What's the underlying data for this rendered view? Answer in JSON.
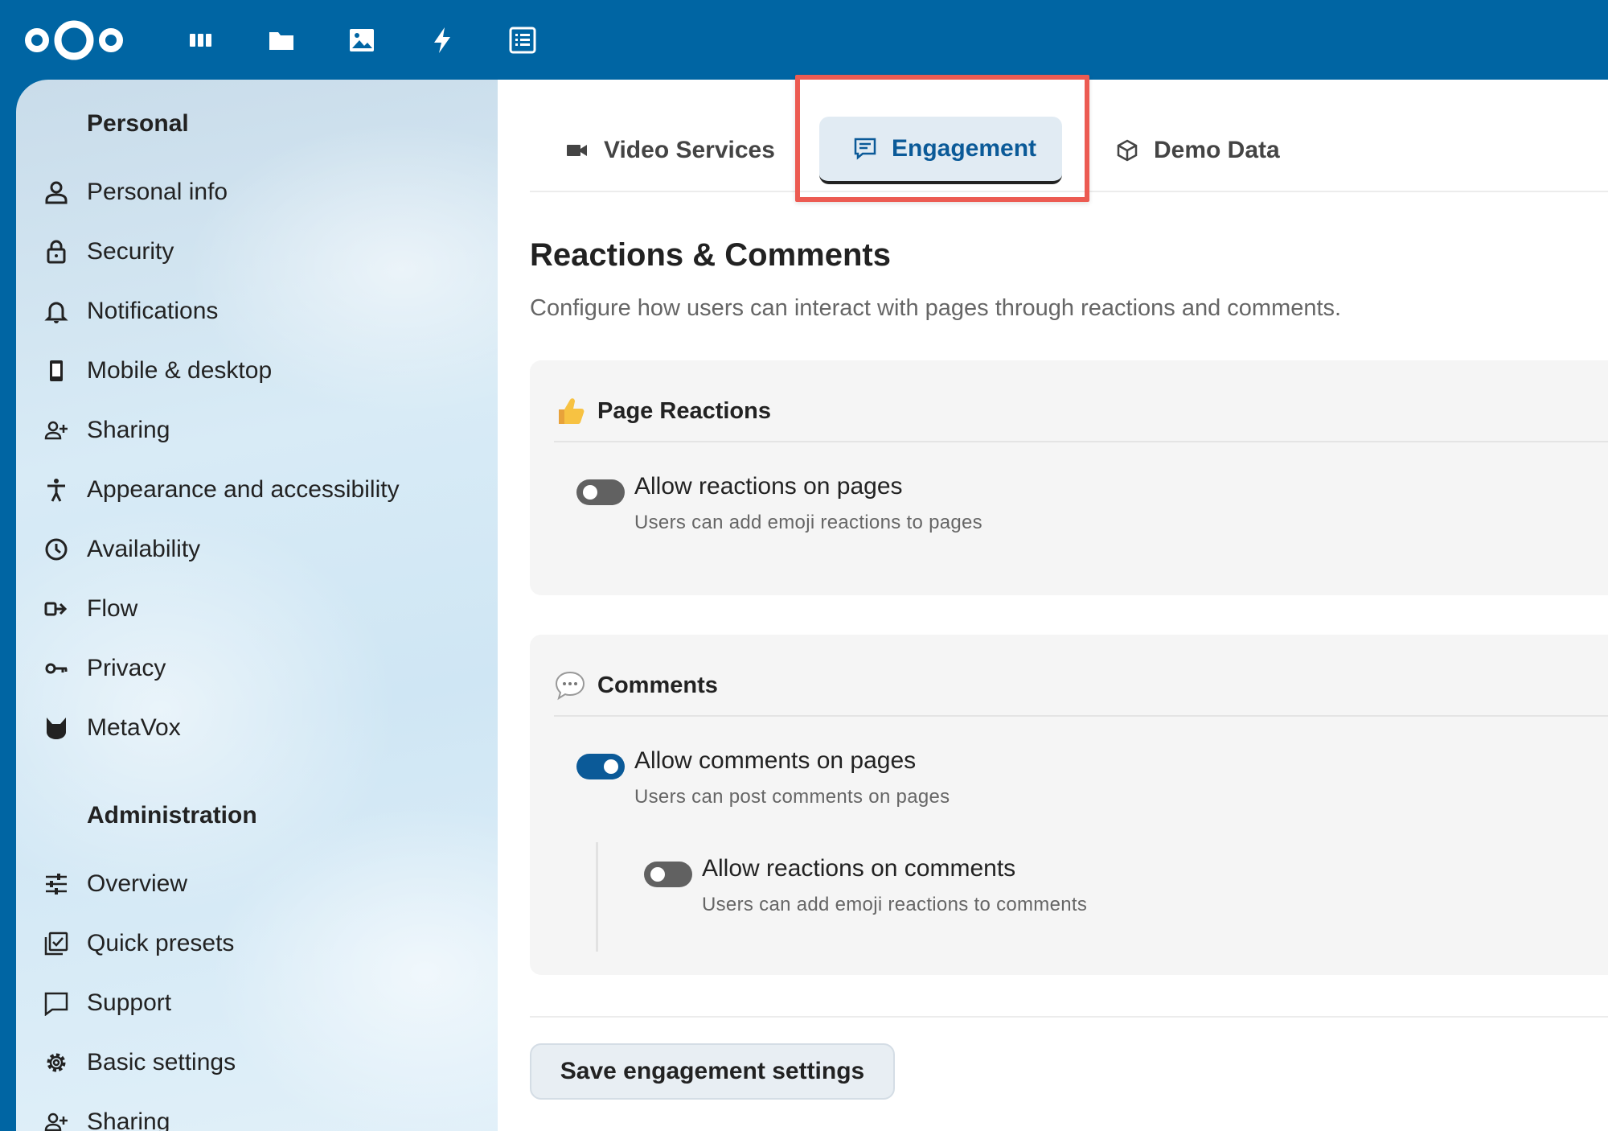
{
  "header": {
    "logo": "nextcloud-logo",
    "apps": [
      {
        "name": "dashboard",
        "icon": "dashboard-icon"
      },
      {
        "name": "files",
        "icon": "folder-icon"
      },
      {
        "name": "photos",
        "icon": "image-icon"
      },
      {
        "name": "activity",
        "icon": "lightning-icon"
      },
      {
        "name": "pages",
        "icon": "list-icon"
      }
    ]
  },
  "sidebar": {
    "personal_heading": "Personal",
    "personal_items": [
      {
        "label": "Personal info",
        "icon": "user-icon"
      },
      {
        "label": "Security",
        "icon": "lock-icon"
      },
      {
        "label": "Notifications",
        "icon": "bell-icon"
      },
      {
        "label": "Mobile & desktop",
        "icon": "phone-icon"
      },
      {
        "label": "Sharing",
        "icon": "share-user-icon"
      },
      {
        "label": "Appearance and accessibility",
        "icon": "accessibility-icon"
      },
      {
        "label": "Availability",
        "icon": "clock-icon"
      },
      {
        "label": "Flow",
        "icon": "flow-icon"
      },
      {
        "label": "Privacy",
        "icon": "key-icon"
      },
      {
        "label": "MetaVox",
        "icon": "metavox-icon"
      }
    ],
    "admin_heading": "Administration",
    "admin_items": [
      {
        "label": "Overview",
        "icon": "sliders-icon"
      },
      {
        "label": "Quick presets",
        "icon": "checklist-icon"
      },
      {
        "label": "Support",
        "icon": "support-icon"
      },
      {
        "label": "Basic settings",
        "icon": "gear-icon"
      },
      {
        "label": "Sharing",
        "icon": "share-user-icon"
      }
    ]
  },
  "tabs": [
    {
      "label": "Video Services",
      "icon": "video-icon",
      "active": false
    },
    {
      "label": "Engagement",
      "icon": "comment-icon",
      "active": true
    },
    {
      "label": "Demo Data",
      "icon": "cube-icon",
      "active": false
    }
  ],
  "main": {
    "title": "Reactions & Comments",
    "description": "Configure how users can interact with pages through reactions and comments.",
    "reactions_card": {
      "title": "Page Reactions",
      "icon": "thumbs-up-emoji",
      "options": [
        {
          "label": "Allow reactions on pages",
          "help": "Users can add emoji reactions to pages",
          "enabled": false
        }
      ]
    },
    "comments_card": {
      "title": "Comments",
      "icon": "speech-bubble-emoji",
      "options": [
        {
          "label": "Allow comments on pages",
          "help": "Users can post comments on pages",
          "enabled": true
        },
        {
          "label": "Allow reactions on comments",
          "help": "Users can add emoji reactions to comments",
          "enabled": false
        }
      ]
    },
    "save_label": "Save engagement settings"
  },
  "colors": {
    "header": "#0065a3",
    "accent": "#0b5a98",
    "highlight": "#ec5b52"
  }
}
